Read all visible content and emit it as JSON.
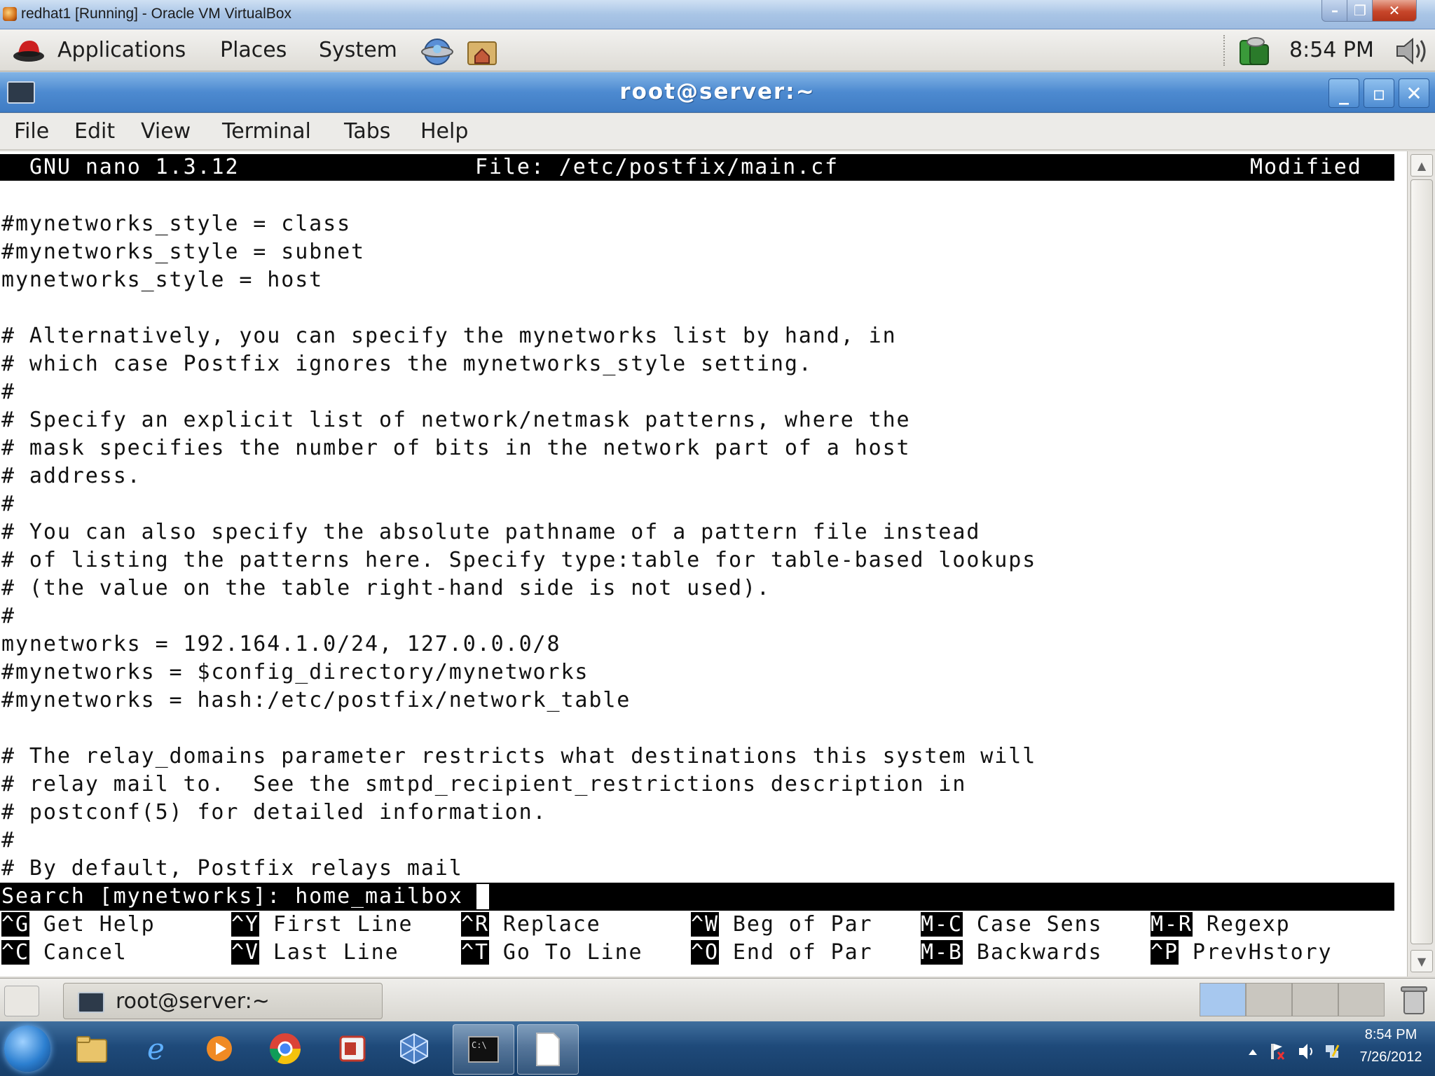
{
  "vbox": {
    "title": "redhat1 [Running] - Oracle VM VirtualBox"
  },
  "gnome_panel": {
    "menus": [
      "Applications",
      "Places",
      "System"
    ],
    "clock": "8:54 PM"
  },
  "terminal_window": {
    "title": "root@server:~",
    "menus": [
      "File",
      "Edit",
      "View",
      "Terminal",
      "Tabs",
      "Help"
    ]
  },
  "nano": {
    "version": "GNU nano 1.3.12",
    "file": "File: /etc/postfix/main.cf",
    "status": "Modified",
    "lines": [
      "",
      "#mynetworks_style = class",
      "#mynetworks_style = subnet",
      "mynetworks_style = host",
      "",
      "# Alternatively, you can specify the mynetworks list by hand, in",
      "# which case Postfix ignores the mynetworks_style setting.",
      "#",
      "# Specify an explicit list of network/netmask patterns, where the",
      "# mask specifies the number of bits in the network part of a host",
      "# address.",
      "#",
      "# You can also specify the absolute pathname of a pattern file instead",
      "# of listing the patterns here. Specify type:table for table-based lookups",
      "# (the value on the table right-hand side is not used).",
      "#",
      "mynetworks = 192.164.1.0/24, 127.0.0.0/8",
      "#mynetworks = $config_directory/mynetworks",
      "#mynetworks = hash:/etc/postfix/network_table",
      "",
      "# The relay_domains parameter restricts what destinations this system will",
      "# relay mail to.  See the smtpd_recipient_restrictions description in",
      "# postconf(5) for detailed information.",
      "#",
      "# By default, Postfix relays mail"
    ],
    "search_prompt": "Search [mynetworks]: home_mailbox",
    "shortcuts": [
      [
        {
          "key": "^G",
          "label": "Get Help"
        },
        {
          "key": "^Y",
          "label": "First Line"
        },
        {
          "key": "^R",
          "label": "Replace"
        },
        {
          "key": "^W",
          "label": "Beg of Par"
        },
        {
          "key": "M-C",
          "label": "Case Sens"
        },
        {
          "key": "M-R",
          "label": "Regexp"
        }
      ],
      [
        {
          "key": "^C",
          "label": "Cancel"
        },
        {
          "key": "^V",
          "label": "Last Line"
        },
        {
          "key": "^T",
          "label": "Go To Line"
        },
        {
          "key": "^O",
          "label": "End of Par"
        },
        {
          "key": "M-B",
          "label": "Backwards"
        },
        {
          "key": "^P",
          "label": "PrevHstory"
        }
      ]
    ]
  },
  "bottom_panel": {
    "task_label": "root@server:~"
  },
  "windows_taskbar": {
    "apps": [
      "explorer-icon",
      "internet-explorer-icon",
      "media-player-icon",
      "chrome-icon",
      "office-icon",
      "virtualbox-icon",
      "cmd-icon",
      "document-icon"
    ],
    "time": "8:54 PM",
    "date": "7/26/2012"
  }
}
